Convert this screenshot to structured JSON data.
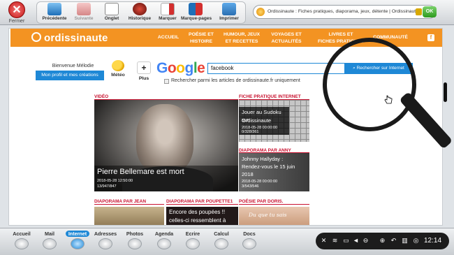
{
  "toolbar": {
    "close_label": "Fermer",
    "tools": [
      {
        "label": "Précédente",
        "icon": "back-arrow-icon"
      },
      {
        "label": "Suivante",
        "icon": "forward-arrow-icon"
      },
      {
        "label": "Onglet",
        "icon": "tab-icon"
      },
      {
        "label": "Historique",
        "icon": "history-icon"
      },
      {
        "label": "Marquer",
        "icon": "bookmark-icon"
      },
      {
        "label": "Marque-pages",
        "icon": "bookmarks-icon"
      },
      {
        "label": "Imprimer",
        "icon": "printer-icon"
      }
    ],
    "url": "Ordissinaute : Fiches pratiques, diaporama, jeux, détente | Ordissinaute",
    "ok_label": "OK"
  },
  "site": {
    "logo": "ordissinaute",
    "nav": [
      {
        "line1": "ACCUEIL",
        "line2": ""
      },
      {
        "line1": "POÉSIE ET",
        "line2": "HISTOIRE"
      },
      {
        "line1": "HUMOUR, JEUX",
        "line2": "ET RECETTES"
      },
      {
        "line1": "VOYAGES ET",
        "line2": "ACTUALITÉS"
      },
      {
        "line1": "LIVRES ET",
        "line2": "FICHES PRATIQUES"
      },
      {
        "line1": "COMMUNAUTÉ",
        "line2": ""
      }
    ],
    "facebook": "f"
  },
  "welcome": {
    "greeting": "Bienvenue Mélodie",
    "profile_button": "Mon profil et mes créations",
    "weather_label": "Météo",
    "plus_symbol": "+",
    "plus_label": "Plus"
  },
  "search": {
    "google": [
      "G",
      "o",
      "o",
      "g",
      "l",
      "e"
    ],
    "value": "facebook",
    "button": "Rechercher sur Internet",
    "checkbox_label": "Rechercher parmi les articles de ordissinaute.fr uniquement"
  },
  "articles": {
    "video": {
      "section": "VIDÉO",
      "title": "Pierre Bellemare est mort",
      "date": "2018-05-28 12:50:00",
      "stats": "13/947/847"
    },
    "fiche": {
      "section": "FICHE PRATIQUE INTERNET",
      "title_line1": "Jouer au Sudoku sur",
      "title_line2": "Ordissinaute",
      "date": "2018-05-28 00:00:00",
      "stats": "0/328/361"
    },
    "diaporama_anny": {
      "section": "DIAPORAMA PAR ANNY",
      "title_line1": "Johnny Hallyday :",
      "title_line2": "Rendez-vous le 15 juin",
      "title_line3": "2018",
      "date": "2018-05-28 00:00:00",
      "stats": "3/543/546"
    },
    "bottom": [
      {
        "section": "DIAPORAMA PAR JEAN",
        "title": ""
      },
      {
        "section": "DIAPORAMA PAR POUPETTE1",
        "title_line1": "Encore des poupées !!",
        "title_line2": "celles-ci ressemblent à"
      },
      {
        "section": "POÉSIE PAR DORIS.",
        "title": "Du que tu sais"
      }
    ]
  },
  "dock": {
    "items": [
      "Accueil",
      "Mail",
      "Internet",
      "Adresses",
      "Photos",
      "Agenda",
      "Ecrire",
      "Calcul",
      "Docs"
    ],
    "active": "Internet",
    "time": "12:14"
  },
  "colors": {
    "brand_orange": "#f39322",
    "accent_blue": "#1e88d6",
    "section_red": "#c8102e"
  }
}
